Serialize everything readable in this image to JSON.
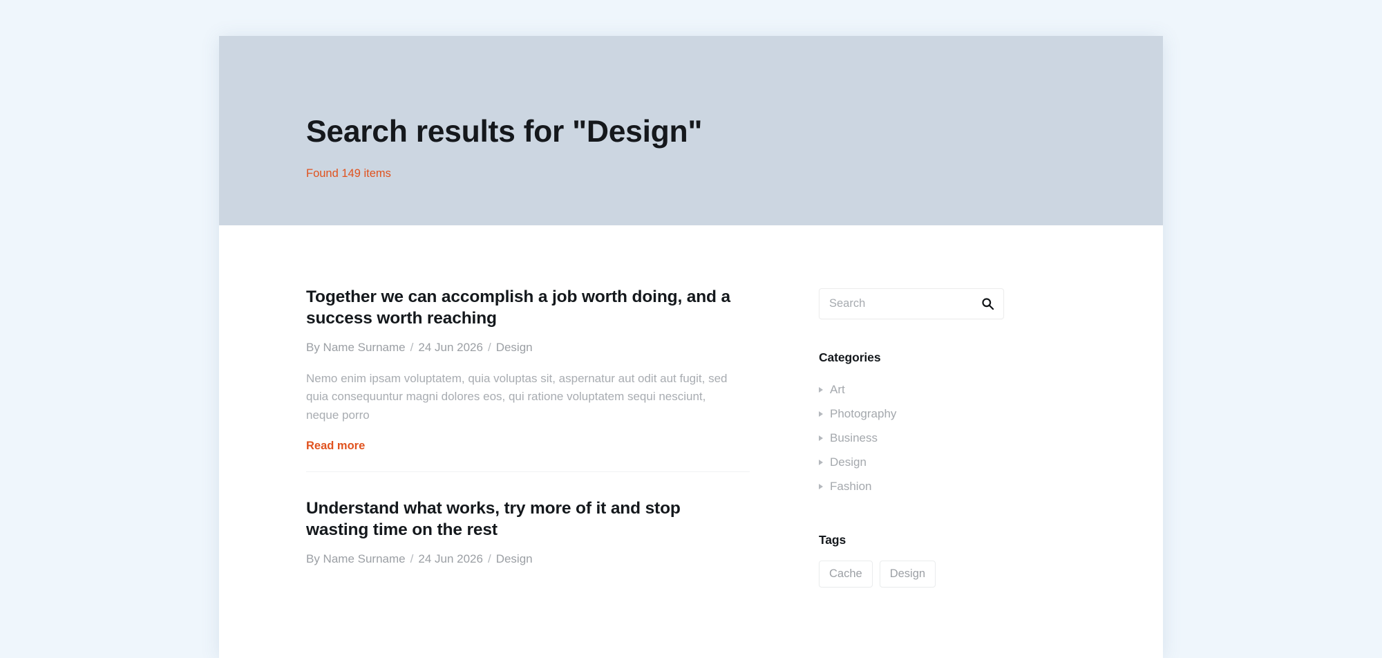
{
  "hero": {
    "title": "Search results for \"Design\"",
    "count_text": "Found 149 items",
    "accent_color": "#e0521e",
    "background_color": "#ccd6e1"
  },
  "page": {
    "background_color": "#eff6fc",
    "card_background": "#ffffff"
  },
  "articles": [
    {
      "title": "Together we can accomplish a job worth doing, and a success worth reaching",
      "author": "By Name Surname",
      "date": "24 Jun 2026",
      "category": "Design",
      "separator": "/",
      "excerpt": "Nemo enim ipsam voluptatem, quia voluptas sit, aspernatur aut odit aut fugit, sed quia consequuntur magni dolores eos, qui ratione voluptatem sequi nesciunt, neque porro",
      "read_more_label": "Read more"
    },
    {
      "title": "Understand what works, try more of it and stop wasting time on the rest",
      "author": "By Name Surname",
      "date": "24 Jun 2026",
      "category": "Design",
      "separator": "/"
    }
  ],
  "sidebar": {
    "search": {
      "placeholder": "Search",
      "value": "",
      "icon": "search-icon"
    },
    "categories": {
      "title": "Categories",
      "items": [
        {
          "label": "Art"
        },
        {
          "label": "Photography"
        },
        {
          "label": "Business"
        },
        {
          "label": "Design"
        },
        {
          "label": "Fashion"
        }
      ]
    },
    "tags": {
      "title": "Tags",
      "items": [
        {
          "label": "Cache"
        },
        {
          "label": "Design"
        }
      ]
    }
  }
}
